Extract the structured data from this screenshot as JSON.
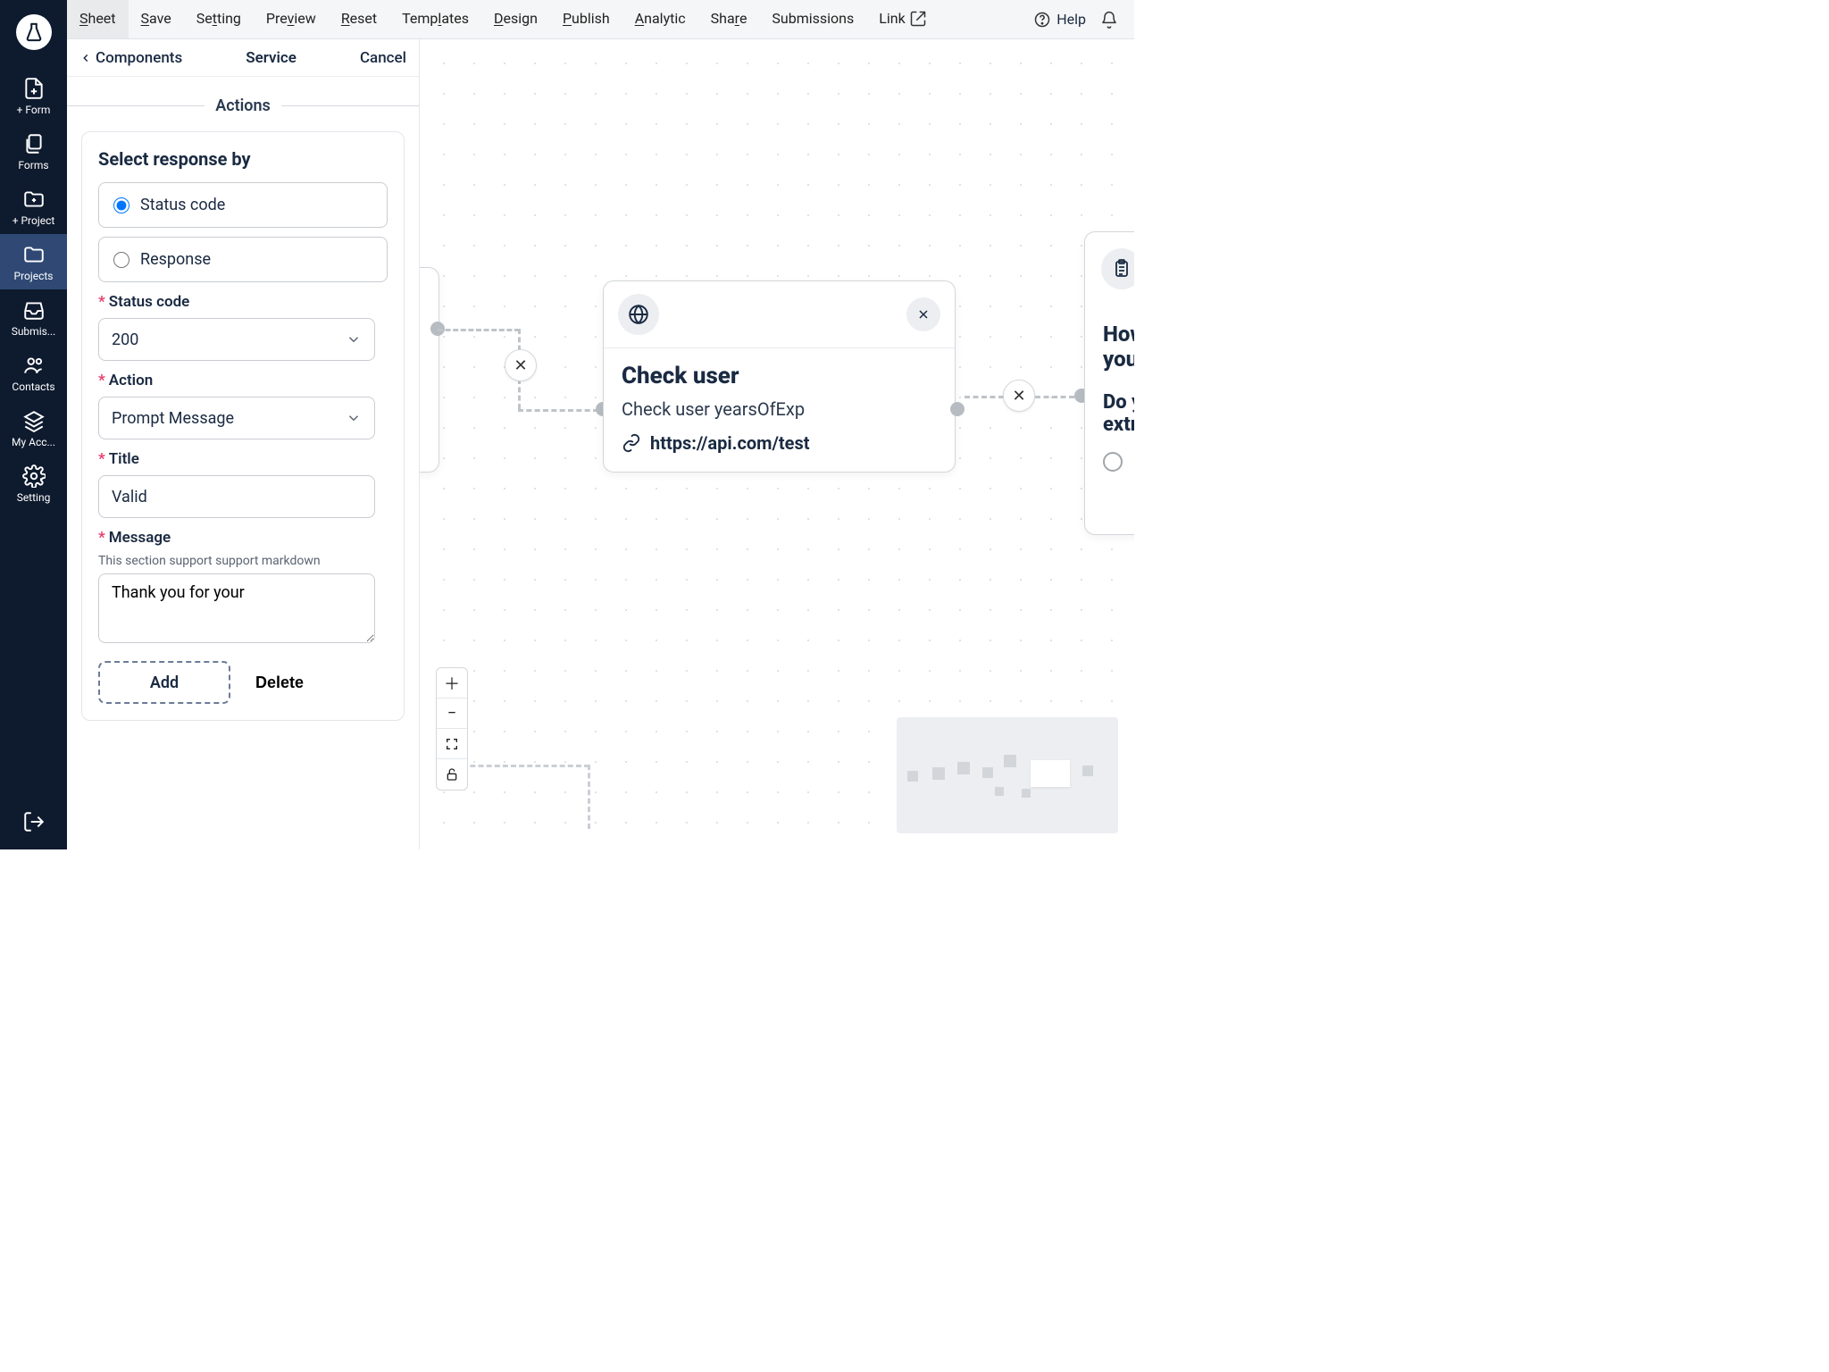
{
  "sidebar": {
    "items": [
      {
        "label": "+ Form"
      },
      {
        "label": "Forms"
      },
      {
        "label": "+ Project"
      },
      {
        "label": "Projects"
      },
      {
        "label": "Submis..."
      },
      {
        "label": "Contacts"
      },
      {
        "label": "My Acc..."
      },
      {
        "label": "Setting"
      }
    ]
  },
  "toolbar": {
    "items": [
      "Sheet",
      "Save",
      "Setting",
      "Preview",
      "Reset",
      "Templates",
      "Design",
      "Publish",
      "Analytic",
      "Share",
      "Submissions",
      "Link"
    ],
    "help": "Help"
  },
  "panel": {
    "back": "Components",
    "center": "Service",
    "cancel": "Cancel",
    "section": "Actions",
    "card": {
      "heading": "Select response by",
      "opt_status": "Status code",
      "opt_response": "Response",
      "status_label": "Status code",
      "status_value": "200",
      "action_label": "Action",
      "action_value": "Prompt Message",
      "title_label": "Title",
      "title_value": "Valid",
      "message_label": "Message",
      "message_help": "This section support support markdown",
      "message_value": "Thank you for your",
      "add": "Add",
      "delete": "Delete"
    }
  },
  "canvas": {
    "node_main": {
      "title": "Check user",
      "desc": "Check user yearsOfExp",
      "url": "https://api.com/test"
    },
    "node_right": {
      "line1": "How many years have you used React?",
      "line2": "Do you want to provide extra info?"
    }
  }
}
